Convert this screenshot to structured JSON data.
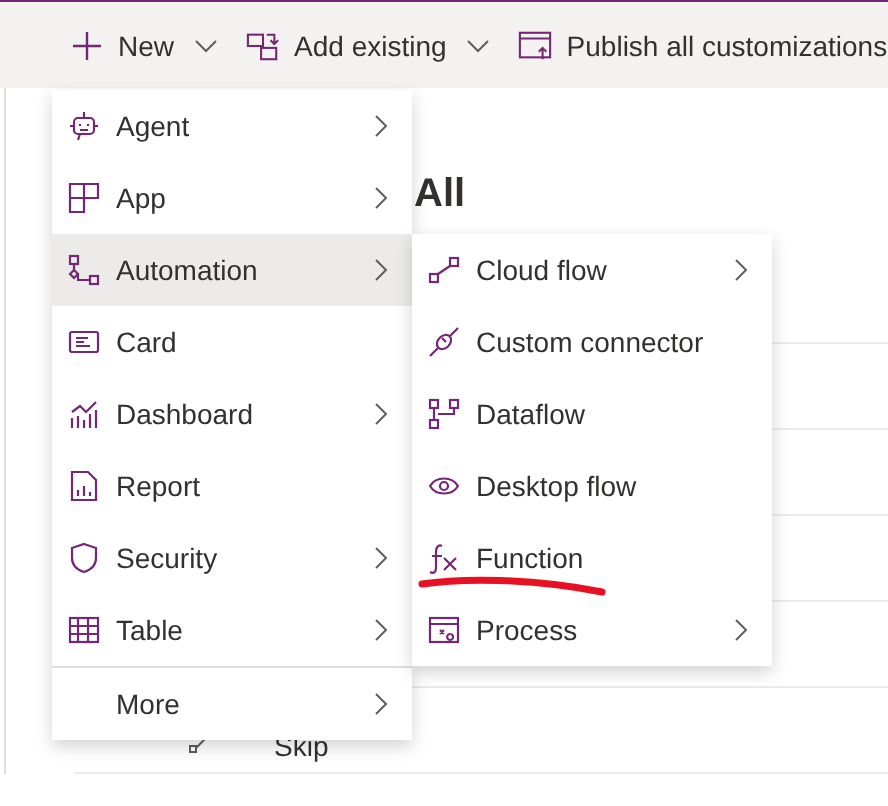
{
  "toolbar": [
    {
      "label": "New",
      "dropdown": true
    },
    {
      "label": "Add existing",
      "dropdown": true
    },
    {
      "label": "Publish all customizations",
      "dropdown": false
    }
  ],
  "heading": "All",
  "rows": [
    {},
    {},
    {},
    {},
    {},
    {
      "name": "Skip"
    }
  ],
  "menu": {
    "items": [
      {
        "label": "Agent",
        "submenu": true,
        "selected": false
      },
      {
        "label": "App",
        "submenu": true,
        "selected": false
      },
      {
        "label": "Automation",
        "submenu": true,
        "selected": true
      },
      {
        "label": "Card",
        "submenu": false,
        "selected": false
      },
      {
        "label": "Dashboard",
        "submenu": true,
        "selected": false
      },
      {
        "label": "Report",
        "submenu": false,
        "selected": false
      },
      {
        "label": "Security",
        "submenu": true,
        "selected": false
      },
      {
        "label": "Table",
        "submenu": true,
        "selected": false
      }
    ],
    "more": {
      "label": "More",
      "submenu": true
    }
  },
  "submenu": {
    "items": [
      {
        "label": "Cloud flow",
        "submenu": true
      },
      {
        "label": "Custom connector",
        "submenu": false
      },
      {
        "label": "Dataflow",
        "submenu": false
      },
      {
        "label": "Desktop flow",
        "submenu": false
      },
      {
        "label": "Function",
        "submenu": false
      },
      {
        "label": "Process",
        "submenu": true
      }
    ]
  }
}
